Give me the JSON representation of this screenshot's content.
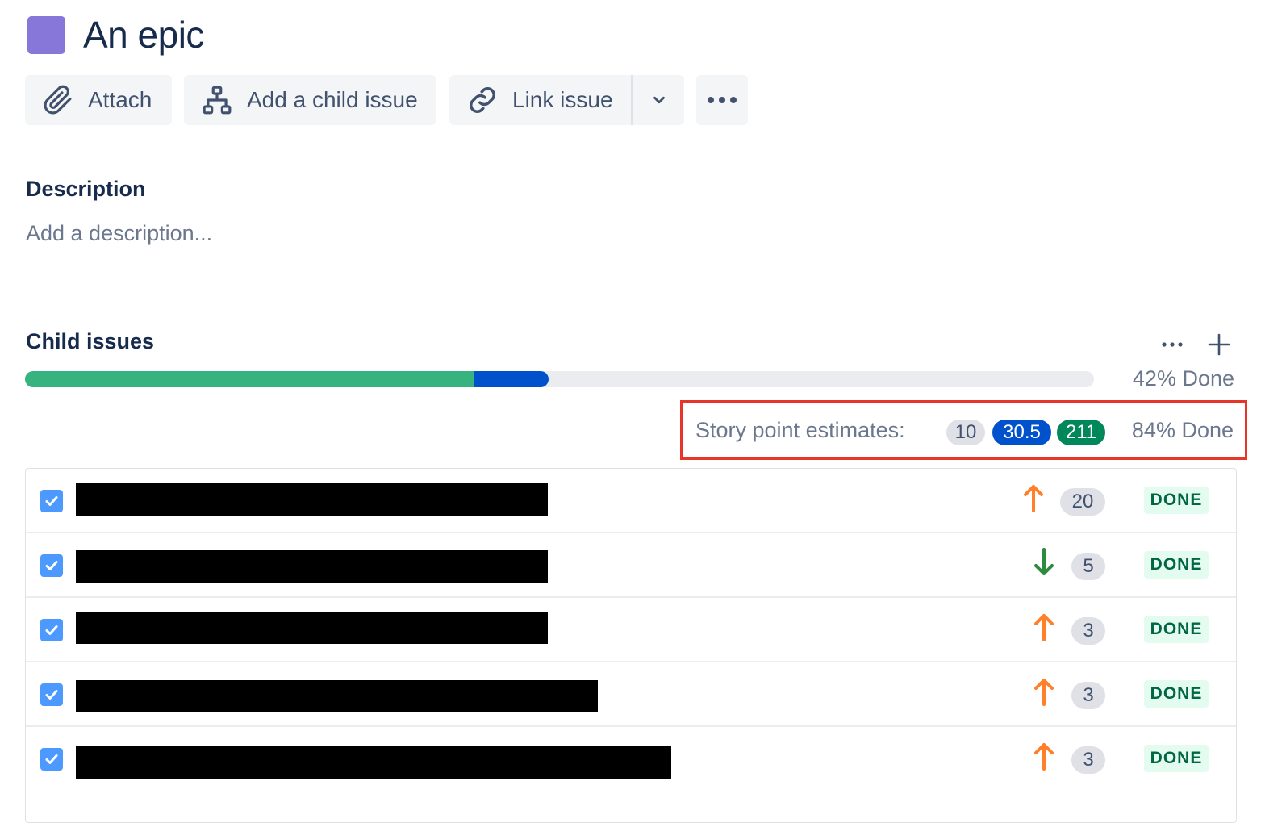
{
  "header": {
    "title": "An epic",
    "epic_color": "#8777d9"
  },
  "toolbar": {
    "attach_label": "Attach",
    "attach_icon": "paperclip-icon",
    "add_child_label": "Add a child issue",
    "add_child_icon": "hierarchy-icon",
    "link_label": "Link issue",
    "link_icon": "link-icon",
    "dropdown_icon": "chevron-down-icon",
    "more_icon": "more-icon"
  },
  "description": {
    "heading": "Description",
    "placeholder": "Add a description..."
  },
  "child_issues": {
    "heading": "Child issues",
    "progress_done_fraction": 0.42,
    "progress_in_progress_fraction": 0.07,
    "progress_label": "42% Done",
    "estimates": {
      "label": "Story point estimates:",
      "todo": "10",
      "in_progress": "30.5",
      "done": "211",
      "percent_label": "84% Done"
    },
    "items": [
      {
        "priority": "high",
        "points": "20",
        "status": "DONE"
      },
      {
        "priority": "low",
        "points": "5",
        "status": "DONE"
      },
      {
        "priority": "high",
        "points": "3",
        "status": "DONE"
      },
      {
        "priority": "high",
        "points": "3",
        "status": "DONE"
      },
      {
        "priority": "high",
        "points": "3",
        "status": "DONE"
      }
    ]
  },
  "colors": {
    "done_green": "#36b37e",
    "in_progress_blue": "#0052cc",
    "priority_high": "#ff7f2a",
    "priority_low": "#2d8a3e",
    "highlight_border": "#e8352a"
  }
}
